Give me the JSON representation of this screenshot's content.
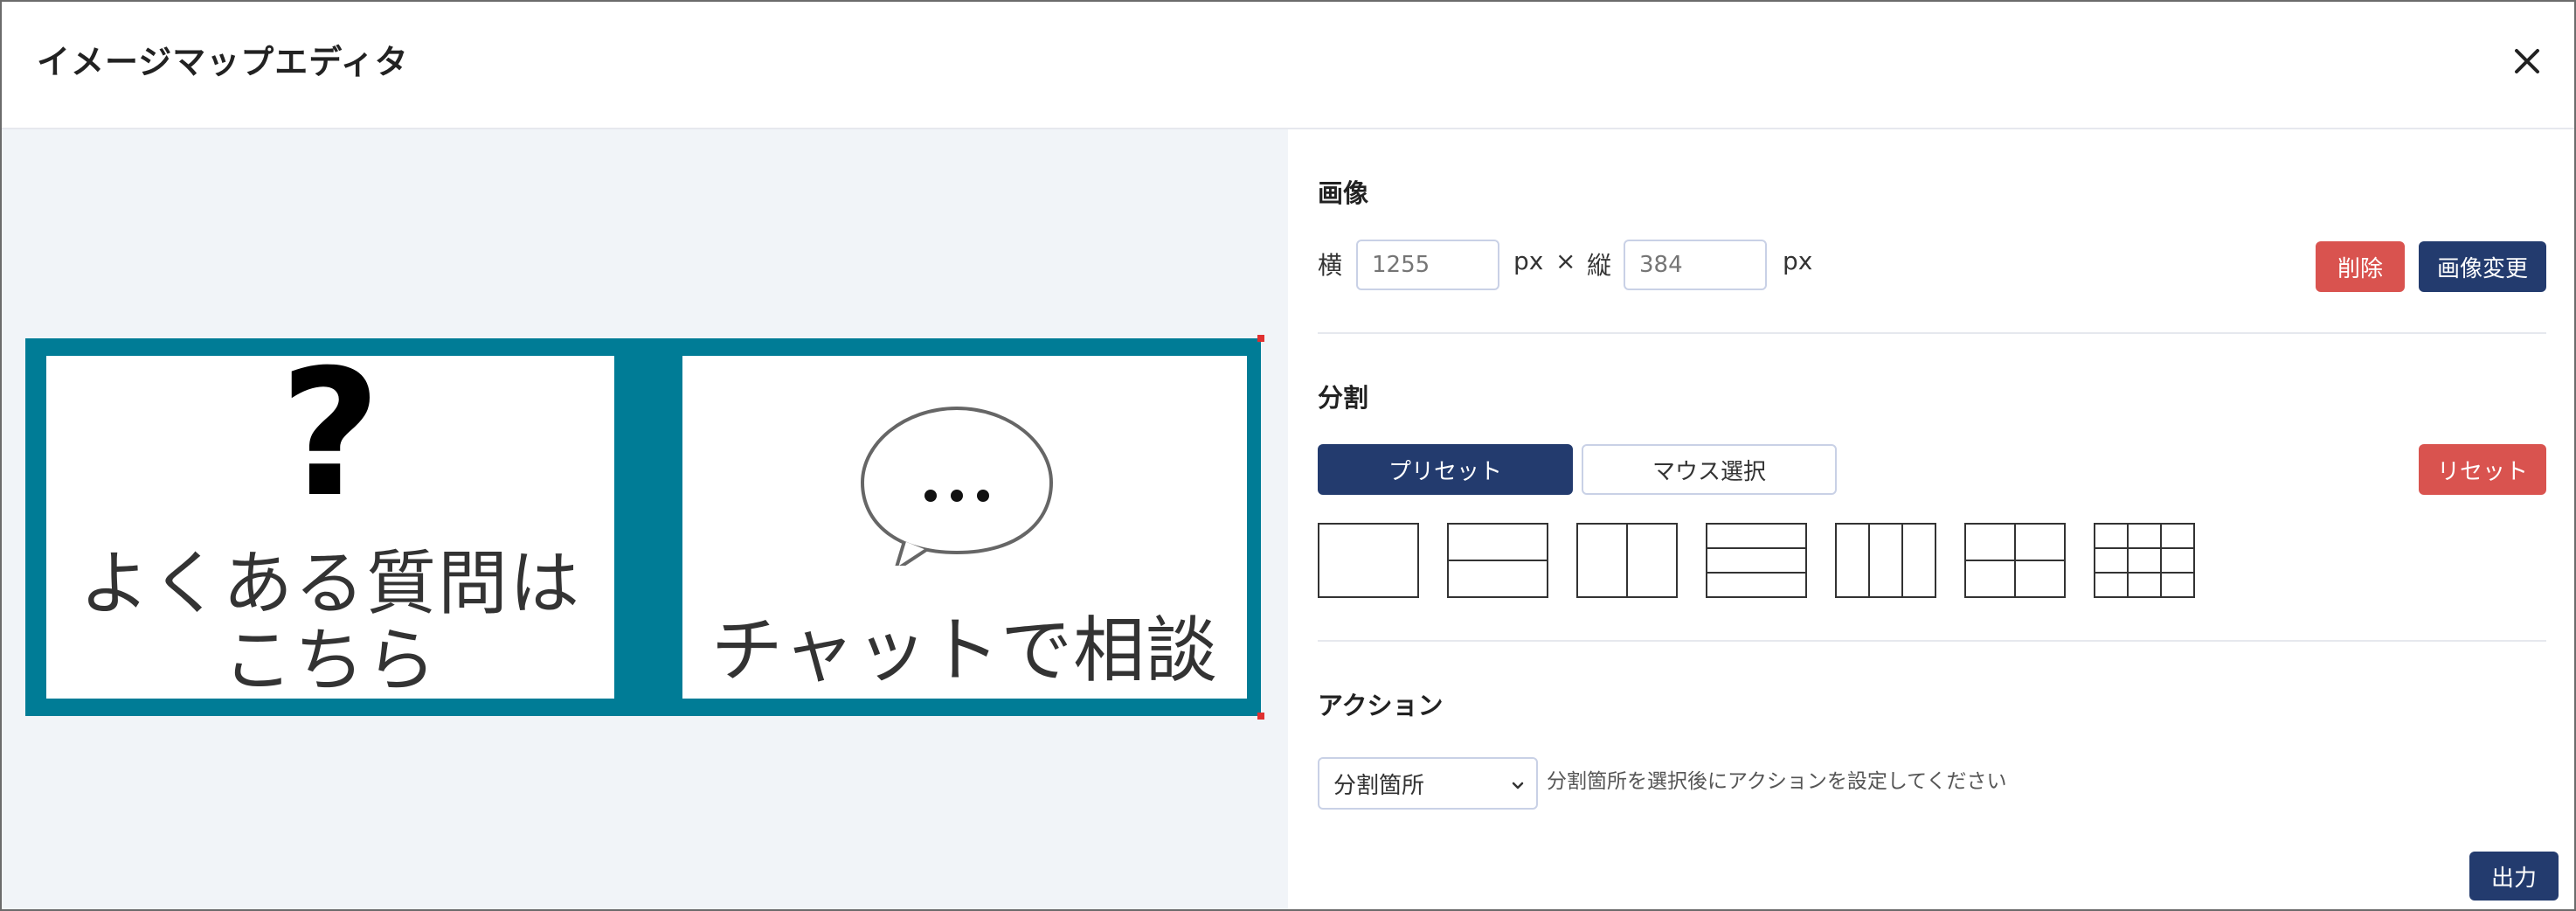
{
  "header": {
    "title": "イメージマップエディタ",
    "close_icon": "close-icon"
  },
  "preview": {
    "background_color": "#007c96",
    "panel1": {
      "line1": "よくある質問は",
      "line2": "こちら",
      "icon": "question-mark"
    },
    "panel2": {
      "bubble_text": "…",
      "line1": "チャットで相談",
      "icon": "speech-bubble"
    }
  },
  "image_section": {
    "title": "画像",
    "width_label": "横",
    "width_value": "1255",
    "unit": "px",
    "times": "×",
    "height_label": "縦",
    "height_value": "384",
    "delete_label": "削除",
    "change_label": "画像変更"
  },
  "split_section": {
    "title": "分割",
    "preset_label": "プリセット",
    "mouse_label": "マウス選択",
    "reset_label": "リセット",
    "presets": [
      "preset-1-full",
      "preset-2-rows",
      "preset-2-cols",
      "preset-3-rows",
      "preset-3-cols",
      "preset-2x2-grid",
      "preset-3x3-grid"
    ]
  },
  "action_section": {
    "title": "アクション",
    "select_value": "分割箇所",
    "hint": "分割箇所を選択後にアクションを設定してください"
  },
  "footer": {
    "output_label": "出力"
  },
  "colors": {
    "navy": "#233b6e",
    "red": "#d9534f",
    "teal": "#007c96",
    "pane_bg": "#f1f4f8"
  }
}
